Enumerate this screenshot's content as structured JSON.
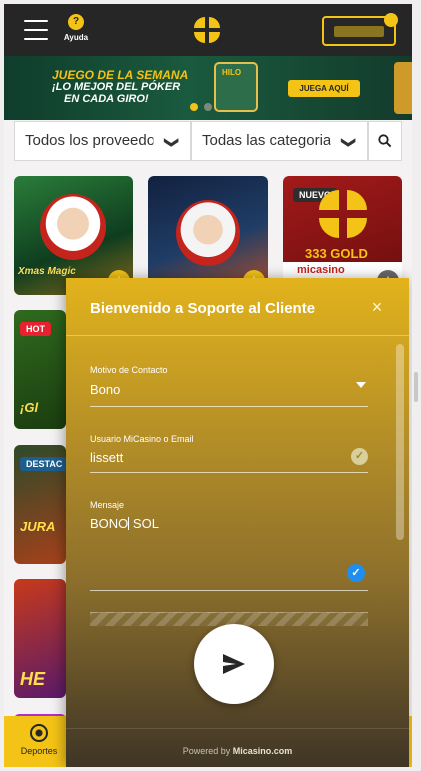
{
  "header": {
    "help_label": "Ayuda",
    "help_icon": "?"
  },
  "banner": {
    "line1": "JUEGO DE LA SEMANA",
    "line2": "¡LO MEJOR DEL PÓKER",
    "line3": "EN CADA GIRO!",
    "card_label": "HILO",
    "cta": "JUEGA AQUÍ"
  },
  "filters": {
    "providers": "Todos los proveedores",
    "categories": "Todas las categorias",
    "chevron": "❯",
    "search_icon": "🔍"
  },
  "games": [
    {
      "title": "Xmas Magic"
    },
    {
      "title": ""
    },
    {
      "badge": "NUEVO",
      "gold": "333 GOLD",
      "brand": "micasino"
    },
    {
      "badge": "HOT",
      "partial": "¡Gl"
    },
    {
      "badge": "DESTAC",
      "partial": "JURA"
    },
    {
      "partial": "HE"
    }
  ],
  "bottom_nav": {
    "sports_label": "Deportes"
  },
  "support_modal": {
    "title": "Bienvenido a Soporte al Cliente",
    "close": "×",
    "reason_label": "Motivo de Contacto",
    "reason_value": "Bono",
    "user_label": "Usuario MiCasino o Email",
    "user_value": "lissett",
    "message_label": "Mensaje",
    "message_part1": "BONO",
    "message_part2": " SOL",
    "check_mark": "✓",
    "powered_by_prefix": "Powered by ",
    "powered_by_brand": "Micasino.com"
  },
  "colors": {
    "brand_yellow": "#f3c316",
    "header_dark": "#262626",
    "check_blue": "#1e8ef0"
  }
}
